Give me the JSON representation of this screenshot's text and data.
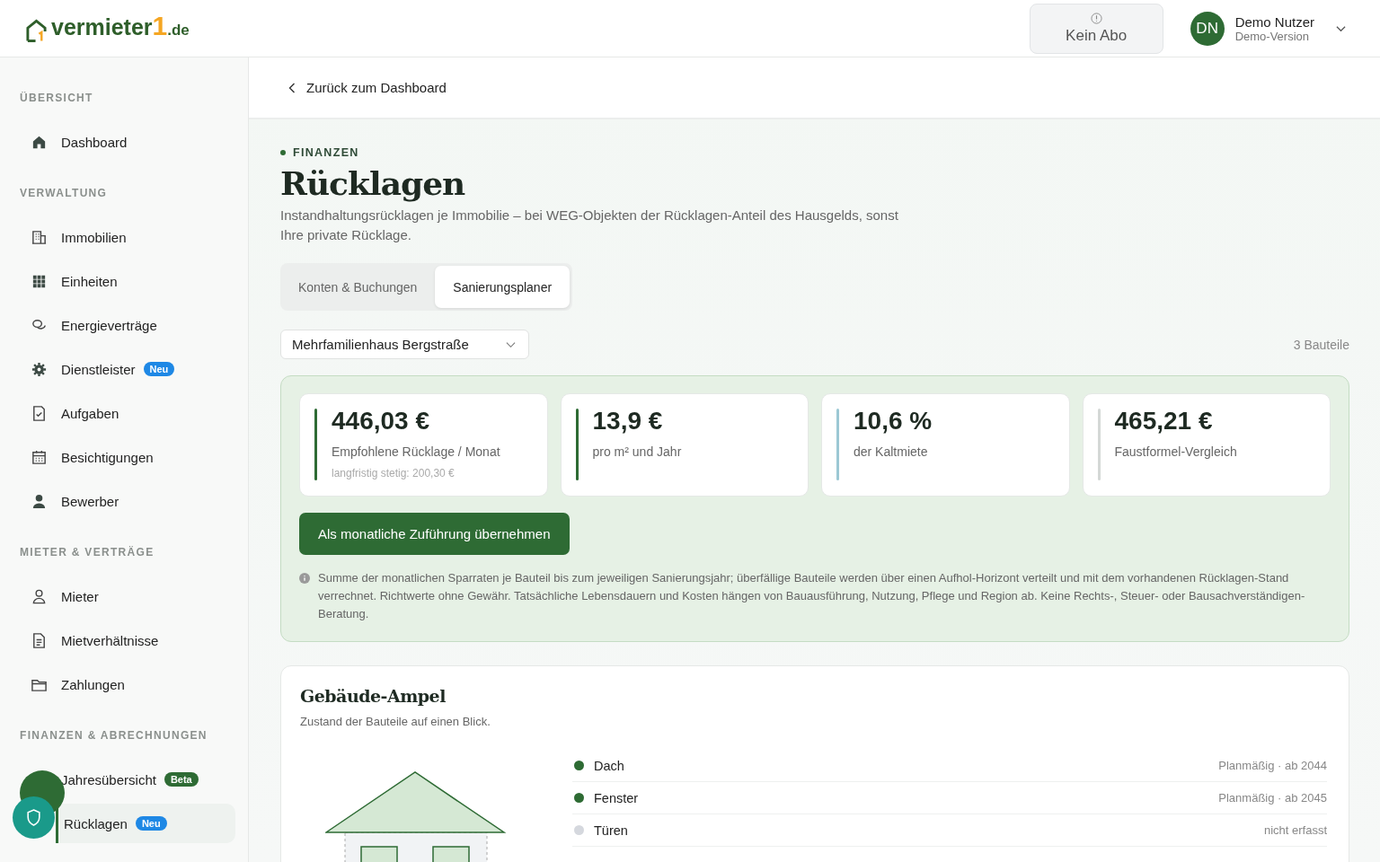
{
  "header": {
    "logo": {
      "word": "vermieter",
      "digit": "1",
      "suffix": ".de"
    },
    "subscription": {
      "label": "Kein Abo"
    },
    "user": {
      "initials": "DN",
      "name": "Demo Nutzer",
      "role": "Demo-Version"
    }
  },
  "sidebar": {
    "sections": [
      {
        "title": "ÜBERSICHT",
        "items": [
          {
            "label": "Dashboard",
            "selected": false
          }
        ]
      },
      {
        "title": "VERWALTUNG",
        "items": [
          {
            "label": "Immobilien",
            "selected": false
          },
          {
            "label": "Einheiten",
            "selected": false
          },
          {
            "label": "Energieverträge",
            "selected": false
          },
          {
            "label": "Dienstleister",
            "selected": false,
            "badge": {
              "text": "Neu",
              "color": "#1e88e5"
            }
          },
          {
            "label": "Aufgaben",
            "selected": false
          },
          {
            "label": "Besichtigungen",
            "selected": false
          },
          {
            "label": "Bewerber",
            "selected": false
          }
        ]
      },
      {
        "title": "MIETER & VERTRÄGE",
        "items": [
          {
            "label": "Mieter",
            "selected": false
          },
          {
            "label": "Mietverhältnisse",
            "selected": false
          },
          {
            "label": "Zahlungen",
            "selected": false
          }
        ]
      },
      {
        "title": "FINANZEN & ABRECHNUNGEN",
        "items": [
          {
            "label": "Jahresübersicht",
            "selected": false,
            "badge": {
              "text": "Beta",
              "color": "#2e6b34"
            }
          },
          {
            "label": "Rücklagen",
            "selected": true,
            "badge": {
              "text": "Neu",
              "color": "#1e88e5"
            }
          }
        ]
      }
    ]
  },
  "back_link": "Zurück zum Dashboard",
  "page": {
    "eyebrow": "FINANZEN",
    "title": "Rücklagen",
    "description": "Instandhaltungsrücklagen je Immobilie – bei WEG-Objekten der Rücklagen-Anteil des Hausgelds, sonst Ihre private Rücklage.",
    "tabs": [
      {
        "label": "Konten & Buchungen",
        "selected": false
      },
      {
        "label": "Sanierungsplaner",
        "selected": true
      }
    ],
    "property_select": {
      "value": "Mehrfamilienhaus Bergstraße"
    },
    "component_count": "3 Bauteile",
    "metrics": [
      {
        "value": "446,03 €",
        "label": "Empfohlene Rücklage / Monat",
        "note": "langfristig stetig: 200,30 €",
        "color": "#2e6b34"
      },
      {
        "value": "13,9 €",
        "label": "pro m² und Jahr",
        "color": "#2e6b34"
      },
      {
        "value": "10,6 %",
        "label": "der Kaltmiete",
        "color": "#9cc8d4"
      },
      {
        "value": "465,21 €",
        "label": "Faustformel-Vergleich",
        "color": "#d4d8d6"
      }
    ],
    "apply_button": "Als monatliche Zuführung übernehmen",
    "info": "Summe der monatlichen Sparraten je Bauteil bis zum jeweiligen Sanierungsjahr; überfällige Bauteile werden über einen Aufhol-Horizont verteilt und mit dem vorhandenen Rücklagen-Stand verrechnet. Richtwerte ohne Gewähr. Tatsächliche Lebensdauern und Kosten hängen von Bauausführung, Nutzung, Pflege und Region ab. Keine Rechts-, Steuer- oder Bausachverständigen-Beratung.",
    "ampel": {
      "title": "Gebäude-Ampel",
      "subtitle": "Zustand der Bauteile auf einen Blick.",
      "components": [
        {
          "name": "Dach",
          "status": "Planmäßig · ab 2044",
          "color": "#2e6b34"
        },
        {
          "name": "Fenster",
          "status": "Planmäßig · ab 2045",
          "color": "#2e6b34"
        },
        {
          "name": "Türen",
          "status": "nicht erfasst",
          "color": "#d5d8de"
        }
      ]
    }
  }
}
